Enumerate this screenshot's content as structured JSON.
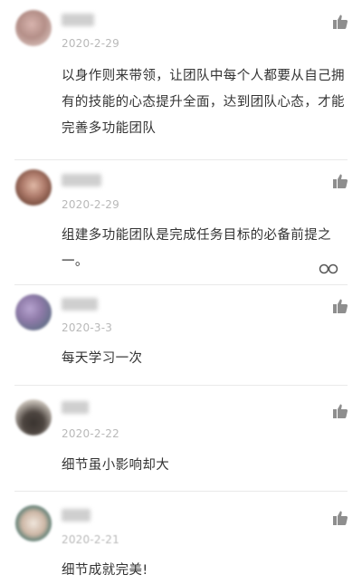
{
  "comments": [
    {
      "date": "2020-2-29",
      "text": "以身作则来带领，让团队中每个人都要从自己拥有的技能的心态提升全面，达到团队心态，才能完善多功能团队",
      "avatar_colors": [
        "#d8b4ae",
        "#8a6b63",
        "#c7a39b"
      ]
    },
    {
      "date": "2020-2-29",
      "text": "组建多功能团队是完成任务目标的必备前提之一。",
      "avatar_colors": [
        "#b07d6d",
        "#6f4537",
        "#d6a694"
      ]
    },
    {
      "date": "2020-3-3",
      "text": "每天学习一次",
      "avatar_colors": [
        "#8e7aa8",
        "#5f6e86",
        "#a4a9b8"
      ]
    },
    {
      "date": "2020-2-22",
      "text": "细节虽小影响却大",
      "avatar_colors": [
        "#3a3430",
        "#9a8d82",
        "#d9d2c9"
      ]
    },
    {
      "date": "2020-2-21",
      "text": "细节成就完美!",
      "avatar_colors": [
        "#1e5e58",
        "#cdb7a6",
        "#f0e6dc"
      ]
    }
  ],
  "icons": {
    "like": "thumbs-up-icon",
    "reply": "reply-bubbles-icon"
  },
  "colors": {
    "text": "#333333",
    "date": "#b9b9b9",
    "icon": "#8e8e8e",
    "divider": "#e9e9e9"
  }
}
